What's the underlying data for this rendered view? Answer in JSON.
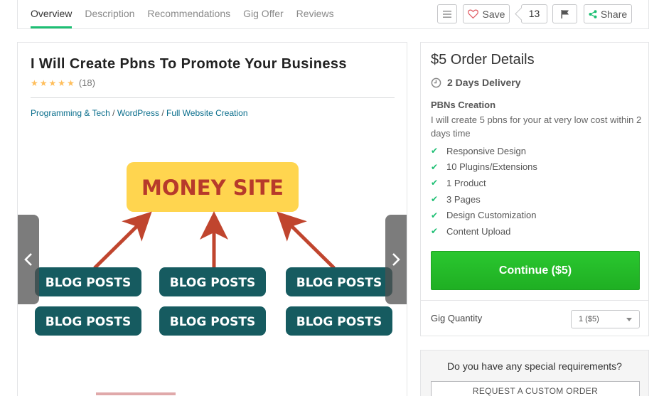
{
  "nav": {
    "tabs": [
      {
        "label": "Overview",
        "active": true
      },
      {
        "label": "Description",
        "active": false
      },
      {
        "label": "Recommendations",
        "active": false
      },
      {
        "label": "Gig Offer",
        "active": false
      },
      {
        "label": "Reviews",
        "active": false
      }
    ],
    "menu_icon": "hamburger-menu-icon",
    "save_label": "Save",
    "save_icon": "heart-icon",
    "save_count": "13",
    "flag_icon": "flag-icon",
    "share_label": "Share",
    "share_icon": "share-icon"
  },
  "gig": {
    "title": "I Will Create Pbns To Promote Your Business",
    "rating_stars": 5,
    "rating_count": "(18)",
    "breadcrumb": [
      {
        "label": "Programming & Tech"
      },
      {
        "separator": " / "
      },
      {
        "label": "WordPress"
      },
      {
        "separator": " / "
      },
      {
        "label": "Full Website Creation"
      }
    ],
    "image": {
      "money_site_label": "MONEY SITE",
      "blog_posts_label": "BLOG POSTS",
      "colors": {
        "money_site_bg": "#ffd54f",
        "money_site_text": "#b73a2b",
        "blog_bg": "#165b60",
        "arrow": "#c0452e"
      }
    }
  },
  "order": {
    "title": "$5 Order Details",
    "delivery_icon": "clock-icon",
    "delivery": "2 Days Delivery",
    "package_name": "PBNs Creation",
    "package_desc": "I will create 5 pbns for your at very low cost within 2 days time",
    "features": [
      "Responsive Design",
      "10 Plugins/Extensions",
      "1 Product",
      "3 Pages",
      "Design Customization",
      "Content Upload"
    ],
    "continue_label": "Continue ($5)",
    "quantity_label": "Gig Quantity",
    "quantity_value": "1 ($5)",
    "accent_color": "#1dbf73",
    "button_color": "#2ac72f"
  },
  "requirements": {
    "question": "Do you have any special requirements?",
    "button_label": "REQUEST A CUSTOM ORDER"
  }
}
